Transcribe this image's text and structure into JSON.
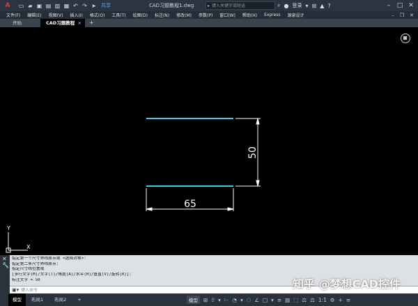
{
  "app": {
    "logo": "A",
    "document_title": "CAD习题教程1.dwg",
    "share_label": "共享",
    "search_placeholder": "键入关键字或短语",
    "login_label": "登录",
    "express_label": "Express"
  },
  "menu": {
    "items": [
      "文件(F)",
      "编辑(E)",
      "视图(V)",
      "插入(I)",
      "格式(O)",
      "工具(T)",
      "绘图(D)",
      "标注(N)",
      "修改(M)",
      "参数(P)",
      "窗口(W)",
      "帮助(H)",
      "Express",
      "源泉设计"
    ]
  },
  "tabs": {
    "home": "开始",
    "active": "CAD习题教程1*",
    "close": "×",
    "add": "+"
  },
  "drawing": {
    "dim_horizontal": "65",
    "dim_vertical": "50",
    "line_color": "#3fd0e0",
    "dim_color": "#ffffff",
    "ucs_x": "X",
    "ucs_y": "Y"
  },
  "command": {
    "history": [
      "指定第一个尺寸界线原点或 <选择对象>:",
      "指定第二条尺寸界线原点:",
      "指定尺寸线位置或",
      "[多行文字(M)/文字(T)/角度(A)/水平(H)/垂直(V)/旋转(R)]:",
      "标注文字 = 50"
    ],
    "input_placeholder": "键入命令"
  },
  "layout_tabs": [
    "模型",
    "布局1",
    "布局2"
  ],
  "status": {
    "model_label": "模型",
    "scale_label": "1:1"
  },
  "watermark": "知乎 @梦想CAD控件"
}
